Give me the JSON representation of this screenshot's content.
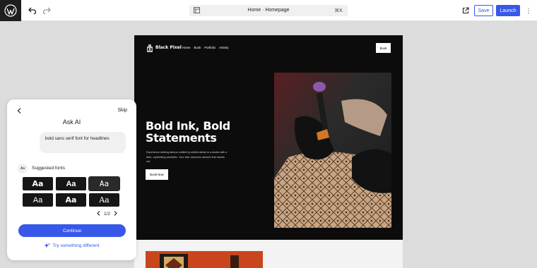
{
  "topbar": {
    "document_title": "Home · Homepage",
    "shortcut": "⌘K",
    "save_label": "Save",
    "launch_label": "Launch",
    "icons": [
      "wordpress-logo",
      "undo-icon",
      "redo-icon",
      "page-icon",
      "external-link-icon",
      "more-vertical-icon"
    ]
  },
  "site": {
    "name": "Black Pixel",
    "nav": [
      "Home",
      "Book",
      "Portfolio",
      "Artistry"
    ],
    "header_button": "Book",
    "hero_title": "Bold Ink, Bold Statements",
    "hero_text": "Experience striking tattoos crafted by skilled artists in a studio with a dark, captivating aesthetic. Your skin deserves artwork that stands out.",
    "hero_button": "Book Now"
  },
  "ai_panel": {
    "title": "Ask AI",
    "skip_label": "Skip",
    "user_message": "bold sans serif font for headlines",
    "avatar_label": "Aa",
    "suggested_label": "Suggested fonts",
    "font_tiles": [
      "Aa",
      "Aa",
      "Aa",
      "Aa",
      "Aa",
      "Aa"
    ],
    "selected_tile_index": 2,
    "pager": "1/2",
    "continue_label": "Continue",
    "try_label": "Try something different"
  },
  "colors": {
    "accent": "#3858e9",
    "site_background": "#0c0c0c",
    "editor_background": "#dcdcdc"
  }
}
